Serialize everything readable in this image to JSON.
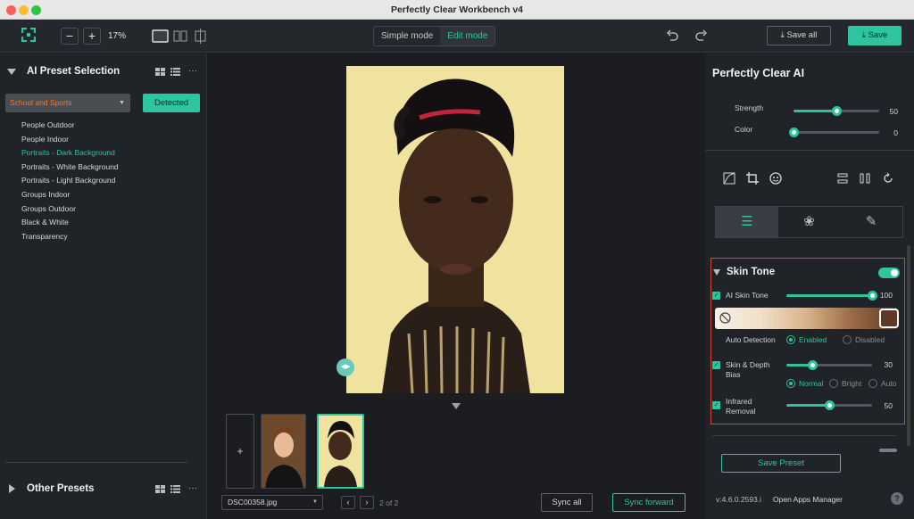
{
  "window": {
    "title": "Perfectly Clear Workbench v4"
  },
  "toolbar": {
    "zoom_minus": "−",
    "zoom_plus": "+",
    "zoom_level": "17%",
    "mode_simple": "Simple mode",
    "mode_edit": "Edit mode",
    "save_all": "Save all",
    "save": "Save"
  },
  "left": {
    "title": "AI Preset Selection",
    "category": "School and Sports",
    "detected": "Detected",
    "presets": [
      "People Outdoor",
      "People Indoor",
      "Portraits - Dark Background",
      "Portraits - White Background",
      "Portraits - Light Background",
      "Groups Indoor",
      "Groups Outdoor",
      "Black & White",
      "Transparency"
    ],
    "selected_index": 2,
    "other_title": "Other Presets"
  },
  "center": {
    "add": "+",
    "filename": "DSC00358.jpg",
    "page": "2 of 2",
    "sync_all": "Sync all",
    "sync_forward": "Sync forward"
  },
  "right": {
    "title": "Perfectly Clear AI",
    "strength_label": "Strength",
    "strength_value": "50",
    "strength_pct": 50,
    "color_label": "Color",
    "color_value": "0",
    "color_pct": 0,
    "skin": {
      "title": "Skin Tone",
      "ai_label": "AI Skin Tone",
      "ai_value": "100",
      "ai_pct": 100,
      "auto_detection": "Auto Detection",
      "enabled": "Enabled",
      "disabled": "Disabled",
      "bias_label1": "Skin & Depth",
      "bias_label2": "Bias",
      "bias_value": "30",
      "bias_pct": 30,
      "normal": "Normal",
      "bright": "Bright",
      "auto": "Auto",
      "ir_label1": "Infrared",
      "ir_label2": "Removal",
      "ir_value": "50",
      "ir_pct": 50
    },
    "save_preset": "Save Preset",
    "version": "v:4.6.0.2593.i",
    "open_apps": "Open Apps Manager",
    "help": "?"
  },
  "colors": {
    "accent": "#2ec4a0",
    "highlight_border": "#d64530",
    "swatch": "#5e3a24"
  }
}
